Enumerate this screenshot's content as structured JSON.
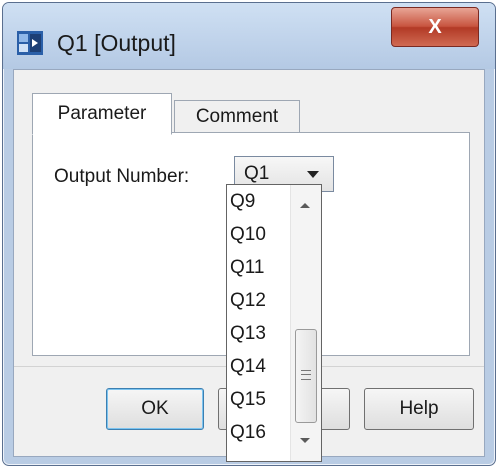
{
  "window": {
    "title": "Q1 [Output]",
    "close_label": "X",
    "icon": "output-block-icon"
  },
  "tabs": [
    {
      "label": "Parameter",
      "active": true
    },
    {
      "label": "Comment",
      "active": false
    }
  ],
  "form": {
    "output_label": "Output Number:",
    "output_value": "Q1"
  },
  "dropdown": {
    "items": [
      "Q9",
      "Q10",
      "Q11",
      "Q12",
      "Q13",
      "Q14",
      "Q15",
      "Q16"
    ]
  },
  "buttons": {
    "ok": "OK",
    "cancel": "",
    "help": "Help"
  },
  "colors": {
    "title_bar": "#b9cce4",
    "close_button": "#c85540",
    "default_button_border": "#3c7fb1"
  }
}
